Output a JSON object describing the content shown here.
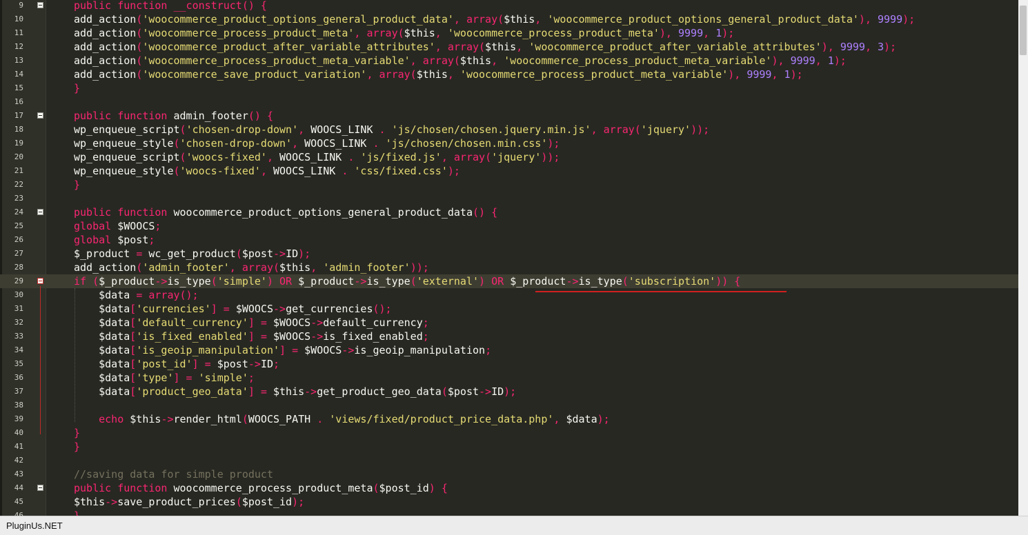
{
  "editor": {
    "first_line": 9,
    "current_line": 29,
    "fold_lines": [
      9,
      17,
      24,
      29,
      44
    ],
    "lines": [
      [
        [
          "k",
          "public function "
        ],
        [
          "fn",
          "__construct"
        ],
        [
          "p",
          "() {"
        ]
      ],
      [
        [
          "",
          "add_action"
        ],
        [
          "p",
          "("
        ],
        [
          "s",
          "'woocommerce_product_options_general_product_data'"
        ],
        [
          "p",
          ", "
        ],
        [
          "k",
          "array"
        ],
        [
          "p",
          "("
        ],
        [
          "",
          "$this"
        ],
        [
          "p",
          ", "
        ],
        [
          "s",
          "'woocommerce_product_options_general_product_data'"
        ],
        [
          "p",
          "), "
        ],
        [
          "n",
          "9999"
        ],
        [
          "p",
          ");"
        ]
      ],
      [
        [
          "",
          "add_action"
        ],
        [
          "p",
          "("
        ],
        [
          "s",
          "'woocommerce_process_product_meta'"
        ],
        [
          "p",
          ", "
        ],
        [
          "k",
          "array"
        ],
        [
          "p",
          "("
        ],
        [
          "",
          "$this"
        ],
        [
          "p",
          ", "
        ],
        [
          "s",
          "'woocommerce_process_product_meta'"
        ],
        [
          "p",
          "), "
        ],
        [
          "n",
          "9999"
        ],
        [
          "p",
          ", "
        ],
        [
          "n",
          "1"
        ],
        [
          "p",
          ");"
        ]
      ],
      [
        [
          "",
          "add_action"
        ],
        [
          "p",
          "("
        ],
        [
          "s",
          "'woocommerce_product_after_variable_attributes'"
        ],
        [
          "p",
          ", "
        ],
        [
          "k",
          "array"
        ],
        [
          "p",
          "("
        ],
        [
          "",
          "$this"
        ],
        [
          "p",
          ", "
        ],
        [
          "s",
          "'woocommerce_product_after_variable_attributes'"
        ],
        [
          "p",
          "), "
        ],
        [
          "n",
          "9999"
        ],
        [
          "p",
          ", "
        ],
        [
          "n",
          "3"
        ],
        [
          "p",
          ");"
        ]
      ],
      [
        [
          "",
          "add_action"
        ],
        [
          "p",
          "("
        ],
        [
          "s",
          "'woocommerce_process_product_meta_variable'"
        ],
        [
          "p",
          ", "
        ],
        [
          "k",
          "array"
        ],
        [
          "p",
          "("
        ],
        [
          "",
          "$this"
        ],
        [
          "p",
          ", "
        ],
        [
          "s",
          "'woocommerce_process_product_meta_variable'"
        ],
        [
          "p",
          "), "
        ],
        [
          "n",
          "9999"
        ],
        [
          "p",
          ", "
        ],
        [
          "n",
          "1"
        ],
        [
          "p",
          ");"
        ]
      ],
      [
        [
          "",
          "add_action"
        ],
        [
          "p",
          "("
        ],
        [
          "s",
          "'woocommerce_save_product_variation'"
        ],
        [
          "p",
          ", "
        ],
        [
          "k",
          "array"
        ],
        [
          "p",
          "("
        ],
        [
          "",
          "$this"
        ],
        [
          "p",
          ", "
        ],
        [
          "s",
          "'woocommerce_process_product_meta_variable'"
        ],
        [
          "p",
          "), "
        ],
        [
          "n",
          "9999"
        ],
        [
          "p",
          ", "
        ],
        [
          "n",
          "1"
        ],
        [
          "p",
          ");"
        ]
      ],
      [
        [
          "p",
          "}"
        ]
      ],
      [],
      [
        [
          "k",
          "public function "
        ],
        [
          "",
          "admin_footer"
        ],
        [
          "p",
          "() {"
        ]
      ],
      [
        [
          "",
          "wp_enqueue_script"
        ],
        [
          "p",
          "("
        ],
        [
          "s",
          "'chosen-drop-down'"
        ],
        [
          "p",
          ", "
        ],
        [
          "",
          "WOOCS_LINK "
        ],
        [
          "p",
          ". "
        ],
        [
          "s",
          "'js/chosen/chosen.jquery.min.js'"
        ],
        [
          "p",
          ", "
        ],
        [
          "k",
          "array"
        ],
        [
          "p",
          "("
        ],
        [
          "s",
          "'jquery'"
        ],
        [
          "p",
          "));"
        ]
      ],
      [
        [
          "",
          "wp_enqueue_style"
        ],
        [
          "p",
          "("
        ],
        [
          "s",
          "'chosen-drop-down'"
        ],
        [
          "p",
          ", "
        ],
        [
          "",
          "WOOCS_LINK "
        ],
        [
          "p",
          ". "
        ],
        [
          "s",
          "'js/chosen/chosen.min.css'"
        ],
        [
          "p",
          ");"
        ]
      ],
      [
        [
          "",
          "wp_enqueue_script"
        ],
        [
          "p",
          "("
        ],
        [
          "s",
          "'woocs-fixed'"
        ],
        [
          "p",
          ", "
        ],
        [
          "",
          "WOOCS_LINK "
        ],
        [
          "p",
          ". "
        ],
        [
          "s",
          "'js/fixed.js'"
        ],
        [
          "p",
          ", "
        ],
        [
          "k",
          "array"
        ],
        [
          "p",
          "("
        ],
        [
          "s",
          "'jquery'"
        ],
        [
          "p",
          "));"
        ]
      ],
      [
        [
          "",
          "wp_enqueue_style"
        ],
        [
          "p",
          "("
        ],
        [
          "s",
          "'woocs-fixed'"
        ],
        [
          "p",
          ", "
        ],
        [
          "",
          "WOOCS_LINK "
        ],
        [
          "p",
          ". "
        ],
        [
          "s",
          "'css/fixed.css'"
        ],
        [
          "p",
          ");"
        ]
      ],
      [
        [
          "p",
          "}"
        ]
      ],
      [],
      [
        [
          "k",
          "public function "
        ],
        [
          "",
          "woocommerce_product_options_general_product_data"
        ],
        [
          "p",
          "() {"
        ]
      ],
      [
        [
          "k",
          "global "
        ],
        [
          "",
          "$WOOCS"
        ],
        [
          "p",
          ";"
        ]
      ],
      [
        [
          "k",
          "global "
        ],
        [
          "",
          "$post"
        ],
        [
          "p",
          ";"
        ]
      ],
      [
        [
          "",
          "$_product "
        ],
        [
          "p",
          "= "
        ],
        [
          "",
          "wc_get_product"
        ],
        [
          "p",
          "("
        ],
        [
          "",
          "$post"
        ],
        [
          "p",
          "->"
        ],
        [
          "",
          "ID"
        ],
        [
          "p",
          ");"
        ]
      ],
      [
        [
          "",
          "add_action"
        ],
        [
          "p",
          "("
        ],
        [
          "s",
          "'admin_footer'"
        ],
        [
          "p",
          ", "
        ],
        [
          "k",
          "array"
        ],
        [
          "p",
          "("
        ],
        [
          "",
          "$this"
        ],
        [
          "p",
          ", "
        ],
        [
          "s",
          "'admin_footer'"
        ],
        [
          "p",
          "));"
        ]
      ],
      [
        [
          "k",
          "if "
        ],
        [
          "p",
          "("
        ],
        [
          "",
          "$_product"
        ],
        [
          "p",
          "->"
        ],
        [
          "",
          "is_type"
        ],
        [
          "p",
          "("
        ],
        [
          "s",
          "'simple'"
        ],
        [
          "p",
          ") "
        ],
        [
          "k",
          "OR "
        ],
        [
          "",
          "$_product"
        ],
        [
          "p",
          "->"
        ],
        [
          "",
          "is_type"
        ],
        [
          "p",
          "("
        ],
        [
          "s",
          "'external'"
        ],
        [
          "p",
          ") "
        ],
        [
          "k",
          "OR "
        ],
        [
          "",
          "$_product"
        ],
        [
          "p",
          "->"
        ],
        [
          "",
          "is_type"
        ],
        [
          "p",
          "("
        ],
        [
          "s",
          "'subscription'"
        ],
        [
          "p",
          ")) {"
        ]
      ],
      [
        [
          "",
          "    $data "
        ],
        [
          "p",
          "= "
        ],
        [
          "k",
          "array"
        ],
        [
          "p",
          "();"
        ]
      ],
      [
        [
          "",
          "    $data"
        ],
        [
          "p",
          "["
        ],
        [
          "s",
          "'currencies'"
        ],
        [
          "p",
          "] = "
        ],
        [
          "",
          "$WOOCS"
        ],
        [
          "p",
          "->"
        ],
        [
          "",
          "get_currencies"
        ],
        [
          "p",
          "();"
        ]
      ],
      [
        [
          "",
          "    $data"
        ],
        [
          "p",
          "["
        ],
        [
          "s",
          "'default_currency'"
        ],
        [
          "p",
          "] = "
        ],
        [
          "",
          "$WOOCS"
        ],
        [
          "p",
          "->"
        ],
        [
          "",
          "default_currency"
        ],
        [
          "p",
          ";"
        ]
      ],
      [
        [
          "",
          "    $data"
        ],
        [
          "p",
          "["
        ],
        [
          "s",
          "'is_fixed_enabled'"
        ],
        [
          "p",
          "] = "
        ],
        [
          "",
          "$WOOCS"
        ],
        [
          "p",
          "->"
        ],
        [
          "",
          "is_fixed_enabled"
        ],
        [
          "p",
          ";"
        ]
      ],
      [
        [
          "",
          "    $data"
        ],
        [
          "p",
          "["
        ],
        [
          "s",
          "'is_geoip_manipulation'"
        ],
        [
          "p",
          "] = "
        ],
        [
          "",
          "$WOOCS"
        ],
        [
          "p",
          "->"
        ],
        [
          "",
          "is_geoip_manipulation"
        ],
        [
          "p",
          ";"
        ]
      ],
      [
        [
          "",
          "    $data"
        ],
        [
          "p",
          "["
        ],
        [
          "s",
          "'post_id'"
        ],
        [
          "p",
          "] = "
        ],
        [
          "",
          "$post"
        ],
        [
          "p",
          "->"
        ],
        [
          "",
          "ID"
        ],
        [
          "p",
          ";"
        ]
      ],
      [
        [
          "",
          "    $data"
        ],
        [
          "p",
          "["
        ],
        [
          "s",
          "'type'"
        ],
        [
          "p",
          "] = "
        ],
        [
          "s",
          "'simple'"
        ],
        [
          "p",
          ";"
        ]
      ],
      [
        [
          "",
          "    $data"
        ],
        [
          "p",
          "["
        ],
        [
          "s",
          "'product_geo_data'"
        ],
        [
          "p",
          "] = "
        ],
        [
          "",
          "$this"
        ],
        [
          "p",
          "->"
        ],
        [
          "",
          "get_product_geo_data"
        ],
        [
          "p",
          "("
        ],
        [
          "",
          "$post"
        ],
        [
          "p",
          "->"
        ],
        [
          "",
          "ID"
        ],
        [
          "p",
          ");"
        ]
      ],
      [],
      [
        [
          "k",
          "    echo "
        ],
        [
          "",
          "$this"
        ],
        [
          "p",
          "->"
        ],
        [
          "",
          "render_html"
        ],
        [
          "p",
          "("
        ],
        [
          "",
          "WOOCS_PATH "
        ],
        [
          "p",
          ". "
        ],
        [
          "s",
          "'views/fixed/product_price_data.php'"
        ],
        [
          "p",
          ", "
        ],
        [
          "",
          "$data"
        ],
        [
          "p",
          ");"
        ]
      ],
      [
        [
          "p",
          "}"
        ]
      ],
      [
        [
          "p",
          "}"
        ]
      ],
      [],
      [
        [
          "c",
          "//saving data for simple product"
        ]
      ],
      [
        [
          "k",
          "public function "
        ],
        [
          "",
          "woocommerce_process_product_meta"
        ],
        [
          "p",
          "("
        ],
        [
          "",
          "$post_id"
        ],
        [
          "p",
          ") {"
        ]
      ],
      [
        [
          "",
          "$this"
        ],
        [
          "p",
          "->"
        ],
        [
          "",
          "save_product_prices"
        ],
        [
          "p",
          "("
        ],
        [
          "",
          "$post_id"
        ],
        [
          "p",
          ");"
        ]
      ],
      [
        [
          "p",
          "}"
        ]
      ]
    ]
  },
  "status": {
    "text": "PluginUs.NET"
  }
}
